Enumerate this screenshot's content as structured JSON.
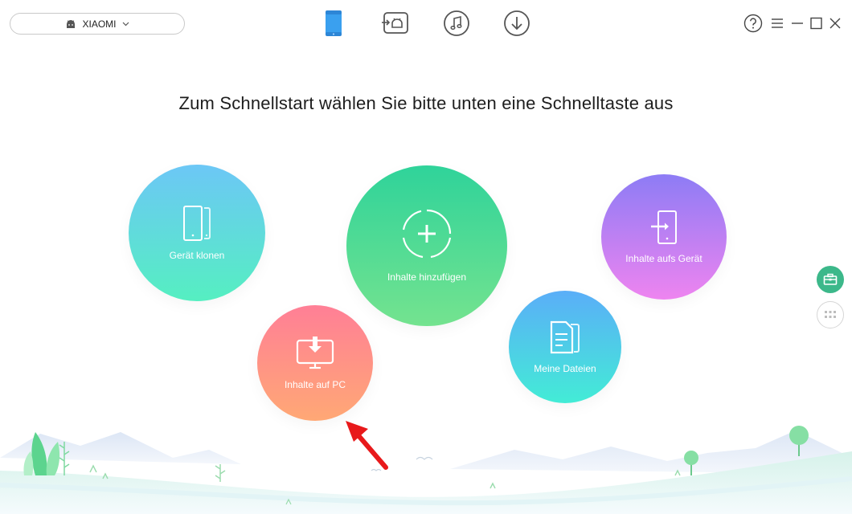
{
  "device_selector": {
    "name": "XIAOMI"
  },
  "headline": "Zum Schnellstart wählen Sie bitte unten eine Schnelltaste aus",
  "nav": {
    "icons": [
      "phone-icon",
      "android-transfer-icon",
      "music-icon",
      "download-icon"
    ],
    "active_color": "#3aa0ef"
  },
  "window_controls": [
    "help-icon",
    "menu-icon",
    "minimize-icon",
    "maximize-icon",
    "close-icon"
  ],
  "shortcuts": {
    "clone": {
      "label": "Gerät klonen"
    },
    "add_content": {
      "label": "Inhalte hinzufügen"
    },
    "to_device": {
      "label": "Inhalte aufs Gerät"
    },
    "to_pc": {
      "label": "Inhalte auf PC"
    },
    "my_files": {
      "label": "Meine Dateien"
    }
  },
  "side_buttons": [
    "toolbox-icon",
    "apps-grid-icon"
  ],
  "colors": {
    "accent_green": "#3cb88a",
    "arrow_red": "#e8191b"
  }
}
